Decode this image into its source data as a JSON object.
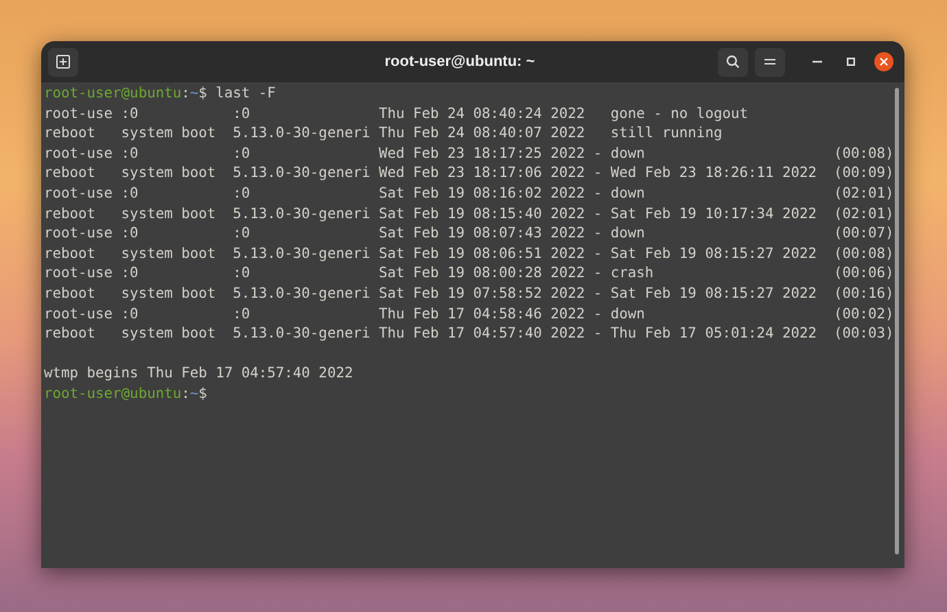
{
  "window": {
    "title": "root-user@ubuntu: ~"
  },
  "prompt": {
    "user_host": "root-user@ubuntu",
    "separator": ":",
    "path": "~",
    "symbol": "$",
    "command": "last -F"
  },
  "output": [
    "root-use :0           :0               Thu Feb 24 08:40:24 2022   gone - no logout",
    "reboot   system boot  5.13.0-30-generi Thu Feb 24 08:40:07 2022   still running",
    "root-use :0           :0               Wed Feb 23 18:17:25 2022 - down                      (00:08)",
    "reboot   system boot  5.13.0-30-generi Wed Feb 23 18:17:06 2022 - Wed Feb 23 18:26:11 2022  (00:09)",
    "root-use :0           :0               Sat Feb 19 08:16:02 2022 - down                      (02:01)",
    "reboot   system boot  5.13.0-30-generi Sat Feb 19 08:15:40 2022 - Sat Feb 19 10:17:34 2022  (02:01)",
    "root-use :0           :0               Sat Feb 19 08:07:43 2022 - down                      (00:07)",
    "reboot   system boot  5.13.0-30-generi Sat Feb 19 08:06:51 2022 - Sat Feb 19 08:15:27 2022  (00:08)",
    "root-use :0           :0               Sat Feb 19 08:00:28 2022 - crash                     (00:06)",
    "reboot   system boot  5.13.0-30-generi Sat Feb 19 07:58:52 2022 - Sat Feb 19 08:15:27 2022  (00:16)",
    "root-use :0           :0               Thu Feb 17 04:58:46 2022 - down                      (00:02)",
    "reboot   system boot  5.13.0-30-generi Thu Feb 17 04:57:40 2022 - Thu Feb 17 05:01:24 2022  (00:03)"
  ],
  "summary": "wtmp begins Thu Feb 17 04:57:40 2022",
  "final_prompt": {
    "user_host": "root-user@ubuntu",
    "separator": ":",
    "path": "~",
    "symbol": "$"
  }
}
